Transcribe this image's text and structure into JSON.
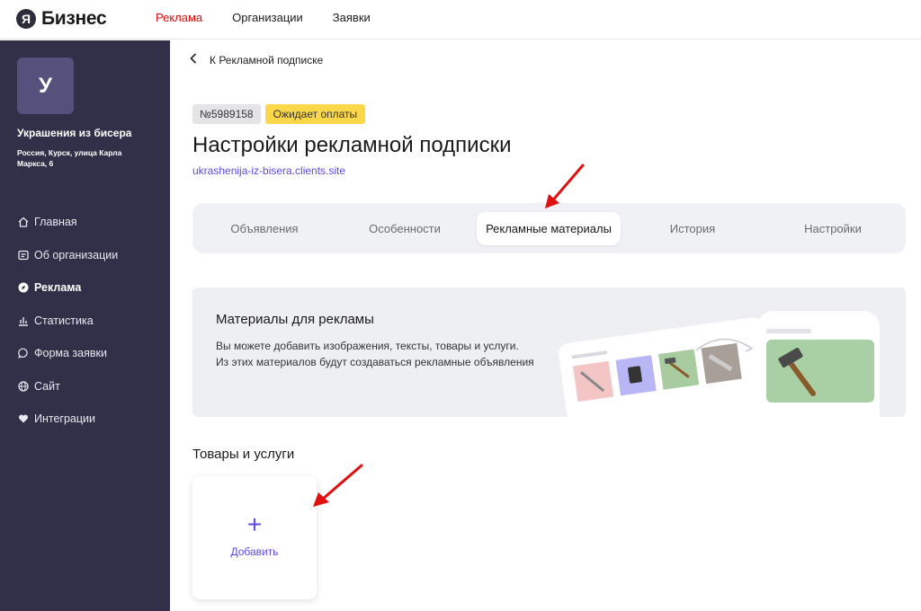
{
  "logo": {
    "mark": "Я",
    "text": "Бизнес"
  },
  "topnav": [
    {
      "label": "Реклама",
      "active": true
    },
    {
      "label": "Организации",
      "active": false
    },
    {
      "label": "Заявки",
      "active": false
    }
  ],
  "sidebar": {
    "avatar_letter": "У",
    "org_name": "Украшения из бисера",
    "org_address": "Россия, Курск, улица Карла Маркса, 6",
    "items": [
      {
        "label": "Главная",
        "icon": "home-icon"
      },
      {
        "label": "Об организации",
        "icon": "info-card-icon"
      },
      {
        "label": "Реклама",
        "icon": "compass-icon",
        "active": true
      },
      {
        "label": "Статистика",
        "icon": "bar-chart-icon"
      },
      {
        "label": "Форма заявки",
        "icon": "chat-bubble-icon"
      },
      {
        "label": "Сайт",
        "icon": "globe-icon"
      },
      {
        "label": "Интеграции",
        "icon": "heart-icon"
      }
    ]
  },
  "main": {
    "back_label": "К Рекламной подписке",
    "number_badge": "№5989158",
    "status_badge": "Ожидает оплаты",
    "title": "Настройки рекламной подписки",
    "site_link": "ukrashenija-iz-bisera.clients.site",
    "tabs": [
      {
        "label": "Объявления"
      },
      {
        "label": "Особенности"
      },
      {
        "label": "Рекламные материалы",
        "active": true
      },
      {
        "label": "История"
      },
      {
        "label": "Настройки"
      }
    ],
    "banner": {
      "title": "Материалы для рекламы",
      "text_line1": "Вы можете добавить изображения, тексты, товары и услуги.",
      "text_line2": "Из этих материалов будут создаваться рекламные объявления"
    },
    "section_title": "Товары и услуги",
    "add_label": "Добавить"
  },
  "colors": {
    "accent": "#5b4ae8",
    "active_nav": "#d50c0c",
    "sidebar_bg": "#323048",
    "status_badge": "#fcd74a",
    "annotation_arrow": "#e01010"
  }
}
